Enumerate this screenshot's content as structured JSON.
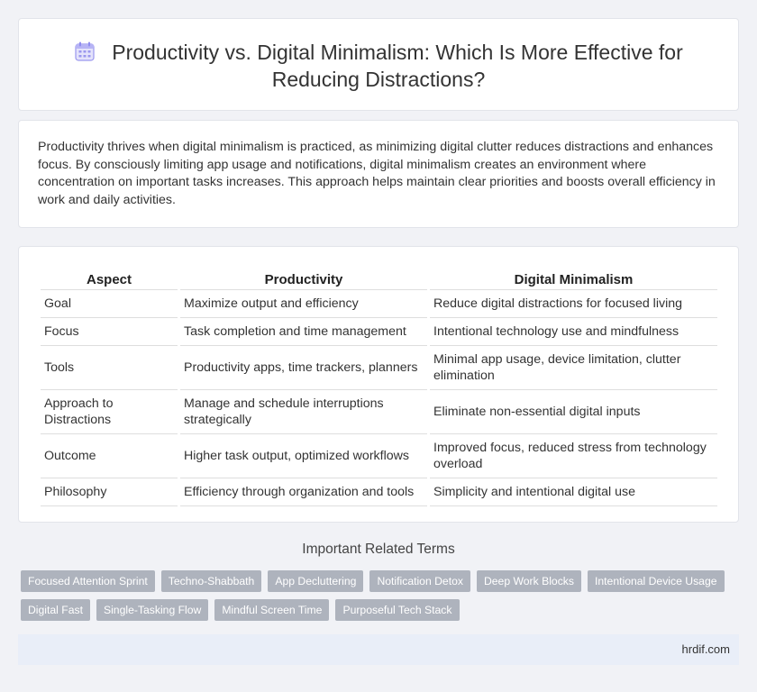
{
  "header": {
    "title": "Productivity vs. Digital Minimalism: Which Is More Effective for Reducing Distractions?",
    "icon": "calendar-icon"
  },
  "summary": {
    "text": "Productivity thrives when digital minimalism is practiced, as minimizing digital clutter reduces distractions and enhances focus. By consciously limiting app usage and notifications, digital minimalism creates an environment where concentration on important tasks increases. This approach helps maintain clear priorities and boosts overall efficiency in work and daily activities."
  },
  "table": {
    "headers": [
      "Aspect",
      "Productivity",
      "Digital Minimalism"
    ],
    "rows": [
      [
        "Goal",
        "Maximize output and efficiency",
        "Reduce digital distractions for focused living"
      ],
      [
        "Focus",
        "Task completion and time management",
        "Intentional technology use and mindfulness"
      ],
      [
        "Tools",
        "Productivity apps, time trackers, planners",
        "Minimal app usage, device limitation, clutter elimination"
      ],
      [
        "Approach to Distractions",
        "Manage and schedule interruptions strategically",
        "Eliminate non-essential digital inputs"
      ],
      [
        "Outcome",
        "Higher task output, optimized workflows",
        "Improved focus, reduced stress from technology overload"
      ],
      [
        "Philosophy",
        "Efficiency through organization and tools",
        "Simplicity and intentional digital use"
      ]
    ]
  },
  "related": {
    "heading": "Important Related Terms",
    "tags": [
      "Focused Attention Sprint",
      "Techno-Shabbath",
      "App Decluttering",
      "Notification Detox",
      "Deep Work Blocks",
      "Intentional Device Usage",
      "Digital Fast",
      "Single-Tasking Flow",
      "Mindful Screen Time",
      "Purposeful Tech Stack"
    ]
  },
  "footer": {
    "site": "hrdif.com"
  },
  "colors": {
    "background": "#f1f2f6",
    "tag": "#aeb3bd",
    "footer": "#e9eef8",
    "icon_accent": "#8f8cf0"
  }
}
